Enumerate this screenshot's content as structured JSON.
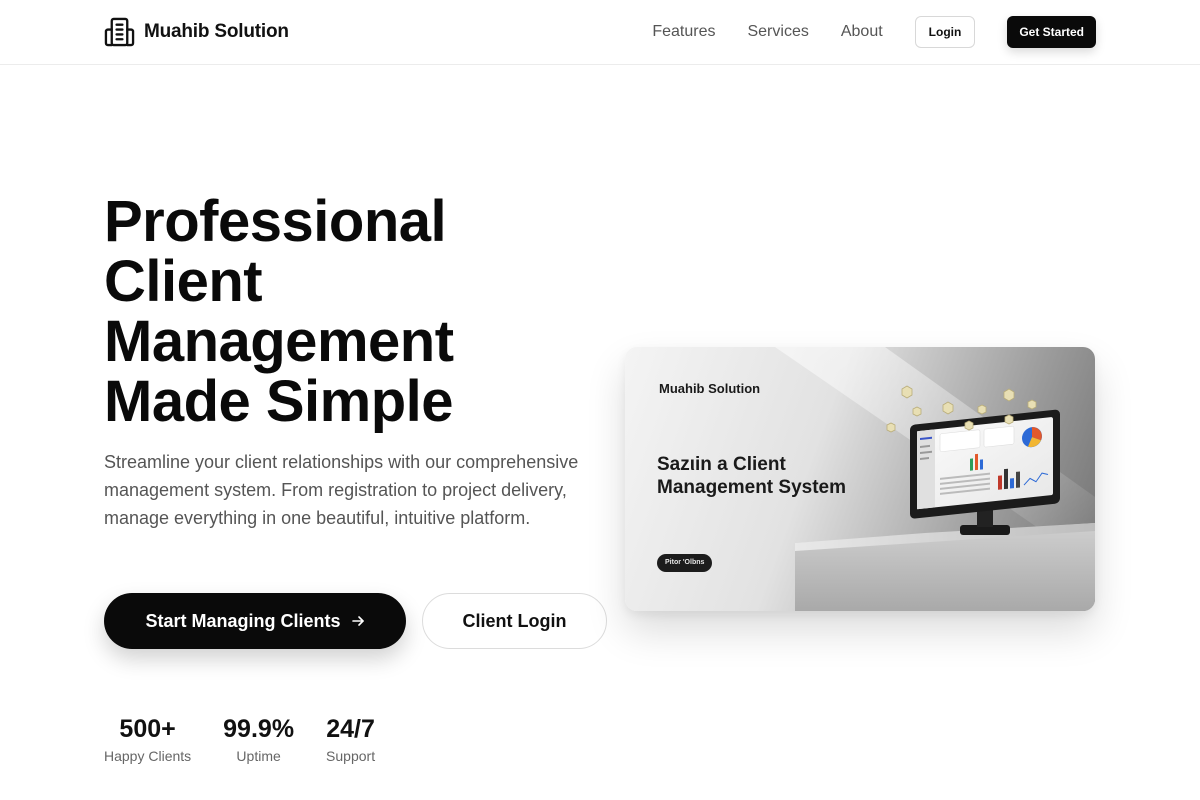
{
  "header": {
    "brand_name": "Muahib Solution",
    "brand_icon": "building-icon",
    "nav_links": [
      {
        "label": "Features"
      },
      {
        "label": "Services"
      },
      {
        "label": "About"
      }
    ],
    "login_label": "Login",
    "cta_label": "Get Started"
  },
  "hero": {
    "title_lines": [
      "Professional",
      "Client",
      "Management",
      "Made Simple"
    ],
    "subtitle": "Streamline your client relationships with our comprehensive management system. From registration to project delivery, manage everything in one beautiful, intuitive platform.",
    "primary_button": {
      "label": "Start Managing Clients",
      "icon": "arrow-right-icon"
    },
    "secondary_button": {
      "label": "Client Login"
    },
    "stats": [
      {
        "value": "500+",
        "label": "Happy Clients"
      },
      {
        "value": "99.9%",
        "label": "Uptime"
      },
      {
        "value": "24/7",
        "label": "Support"
      }
    ],
    "image": {
      "brand": "Muahib Solution",
      "headline_line1": "Sazιin a Client",
      "headline_line2": "Management System",
      "pill": "Pitor 'Olbns"
    }
  },
  "colors": {
    "primary": "#0a0a0a",
    "text_muted": "#555555",
    "border": "#dcdcdc",
    "background": "#ffffff"
  }
}
